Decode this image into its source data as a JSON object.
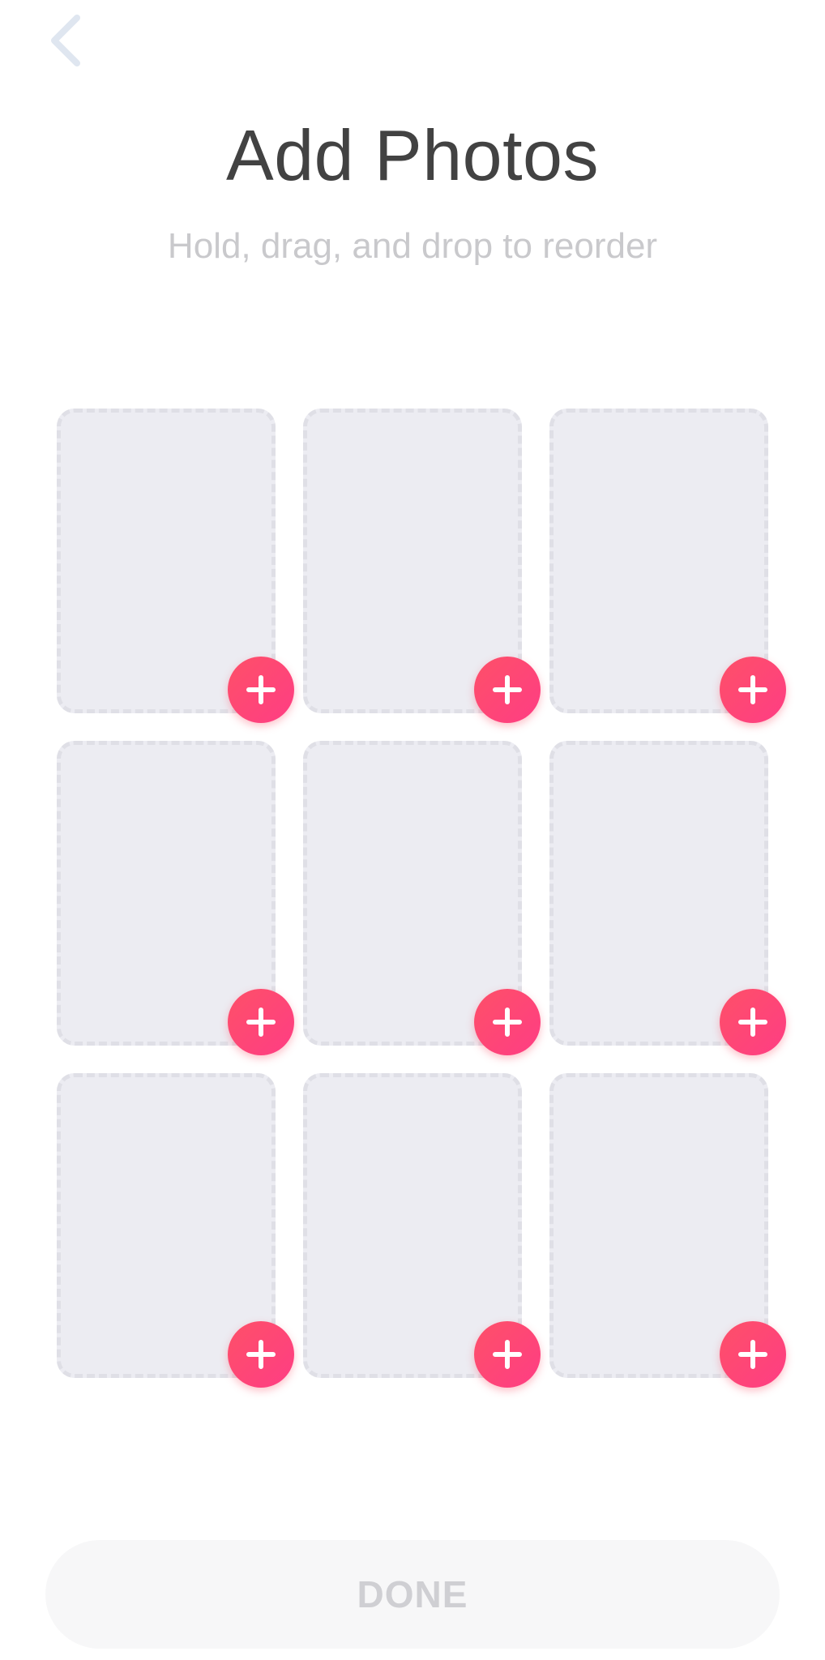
{
  "header": {
    "back_icon": "chevron-left-icon",
    "title": "Add Photos",
    "subtitle": "Hold, drag, and drop to reorder"
  },
  "photo_grid": {
    "slots": [
      {
        "slot": 1,
        "add_icon": "plus-icon"
      },
      {
        "slot": 2,
        "add_icon": "plus-icon"
      },
      {
        "slot": 3,
        "add_icon": "plus-icon"
      },
      {
        "slot": 4,
        "add_icon": "plus-icon"
      },
      {
        "slot": 5,
        "add_icon": "plus-icon"
      },
      {
        "slot": 6,
        "add_icon": "plus-icon"
      },
      {
        "slot": 7,
        "add_icon": "plus-icon"
      },
      {
        "slot": 8,
        "add_icon": "plus-icon"
      },
      {
        "slot": 9,
        "add_icon": "plus-icon"
      }
    ]
  },
  "footer": {
    "done_label": "DONE"
  },
  "colors": {
    "accent_start": "#fd5068",
    "accent_end": "#ff3d84",
    "slot_fill": "#ececf2",
    "title_text": "#424242",
    "subtitle_text": "#c9c9cc",
    "disabled_text": "#cfcfd3",
    "back_icon": "#dfe6f0"
  }
}
